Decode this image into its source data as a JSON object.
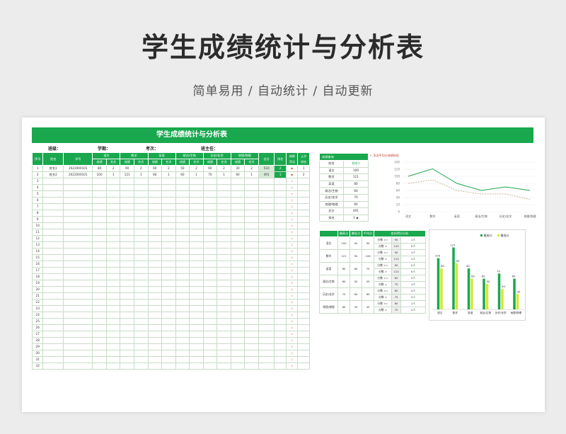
{
  "page": {
    "title": "学生成绩统计与分析表",
    "subtitle": "简单易用  /  自动统计  /  自动更新"
  },
  "sheet": {
    "banner": "学生成绩统计与分析表",
    "info": {
      "class_label": "班级：",
      "term_label": "学期：",
      "exam_label": "考次：",
      "teacher_label": "班主任："
    },
    "headers": {
      "seq": "序号",
      "name": "姓名",
      "id": "学号",
      "subjects": [
        "语文",
        "数学",
        "英语",
        "政治/生物",
        "历史/化学",
        "地理/物理"
      ],
      "score": "成绩",
      "rank": "名次",
      "total": "总分",
      "place": "排名",
      "trend": "成绩\n浮动",
      "last": "上次\n排名"
    },
    "students": [
      {
        "seq": "1",
        "name": "姓名1",
        "id": "2022000101",
        "scores": [
          "80",
          "2",
          "90",
          "2",
          "60",
          "2",
          "50",
          "2",
          "60",
          "2",
          "30",
          "2"
        ],
        "total": "510",
        "place": "2",
        "trend": "◆",
        "last": "1"
      },
      {
        "seq": "2",
        "name": "姓名2",
        "id": "2022000101",
        "scores": [
          "100",
          "1",
          "121",
          "1",
          "80",
          "1",
          "60",
          "1",
          "70",
          "1",
          "60",
          "1"
        ],
        "total": "491",
        "place": "1",
        "trend": "◆",
        "last": "2"
      }
    ],
    "empty_row_count": 30,
    "empty_trend": "◇"
  },
  "query": {
    "title": "成绩查询",
    "col_name": "姓名",
    "col_selected": "姓名1",
    "rows": [
      [
        "语文",
        "100"
      ],
      [
        "数学",
        "121"
      ],
      [
        "英语",
        "80"
      ],
      [
        "政治/生物",
        "60"
      ],
      [
        "历史/化学",
        "70"
      ],
      [
        "地理/物理",
        "60"
      ],
      [
        "总分",
        "491"
      ],
      [
        "排名",
        "1 ◆"
      ]
    ]
  },
  "stats": {
    "headers": [
      "最高分",
      "最低分",
      "平均分",
      "各科得分分析"
    ],
    "subjects": [
      {
        "name": "语文",
        "max": "100",
        "min": "90",
        "avg": "90",
        "bands": [
          [
            "分数 >=",
            "90",
            "1人"
          ],
          [
            "分数 <",
            "120",
            "0人"
          ]
        ]
      },
      {
        "name": "数学",
        "max": "121",
        "min": "90",
        "avg": "106",
        "bands": [
          [
            "分数 >=",
            "90",
            "1人"
          ],
          [
            "分数 <",
            "110",
            "1人"
          ]
        ]
      },
      {
        "name": "英语",
        "max": "80",
        "min": "60",
        "avg": "70",
        "bands": [
          [
            "分数 >=",
            "90",
            "2人"
          ],
          [
            "分数 <",
            "110",
            "0人"
          ]
        ]
      },
      {
        "name": "政治/生物",
        "max": "60",
        "min": "50",
        "avg": "55",
        "bands": [
          [
            "分数 >=",
            "60",
            "2人"
          ],
          [
            "分数 <",
            "75",
            "1人"
          ]
        ]
      },
      {
        "name": "历史/化学",
        "max": "70",
        "min": "60",
        "avg": "65",
        "bands": [
          [
            "分数 >=",
            "60",
            "2人"
          ],
          [
            "分数 <",
            "75",
            "2人"
          ]
        ]
      },
      {
        "name": "地理/物理",
        "max": "60",
        "min": "30",
        "avg": "45",
        "bands": [
          [
            "分数 >=",
            "60",
            "1人"
          ],
          [
            "分数 <",
            "75",
            "2人"
          ]
        ]
      }
    ]
  },
  "colors": {
    "green": "#19a84e",
    "lime": "#d2e834",
    "dash": "#c8b49a",
    "red": "#c0392b"
  },
  "chart_data": [
    {
      "type": "line",
      "title": "← 本次平均分成绩较低",
      "categories": [
        "语文",
        "数学",
        "英语",
        "政治/生物",
        "历史/化学",
        "地理/物理"
      ],
      "ylim": [
        0,
        140
      ],
      "yticks": [
        0,
        20,
        40,
        60,
        80,
        100,
        120,
        140
      ],
      "series": [
        {
          "values": [
            100,
            121,
            80,
            60,
            70,
            60
          ],
          "style": "solid"
        },
        {
          "values": [
            80,
            90,
            60,
            50,
            50,
            35
          ],
          "style": "dashed"
        }
      ]
    },
    {
      "type": "bar",
      "categories": [
        "语文",
        "数学",
        "英语",
        "政治/生物",
        "历史/化学",
        "地理/物理"
      ],
      "series": [
        {
          "name": "最高分",
          "values": [
            100,
            121,
            80,
            60,
            70,
            60
          ]
        },
        {
          "name": "最低分",
          "values": [
            80,
            90,
            60,
            50,
            40,
            30
          ]
        }
      ],
      "ylim": [
        0,
        130
      ]
    }
  ]
}
